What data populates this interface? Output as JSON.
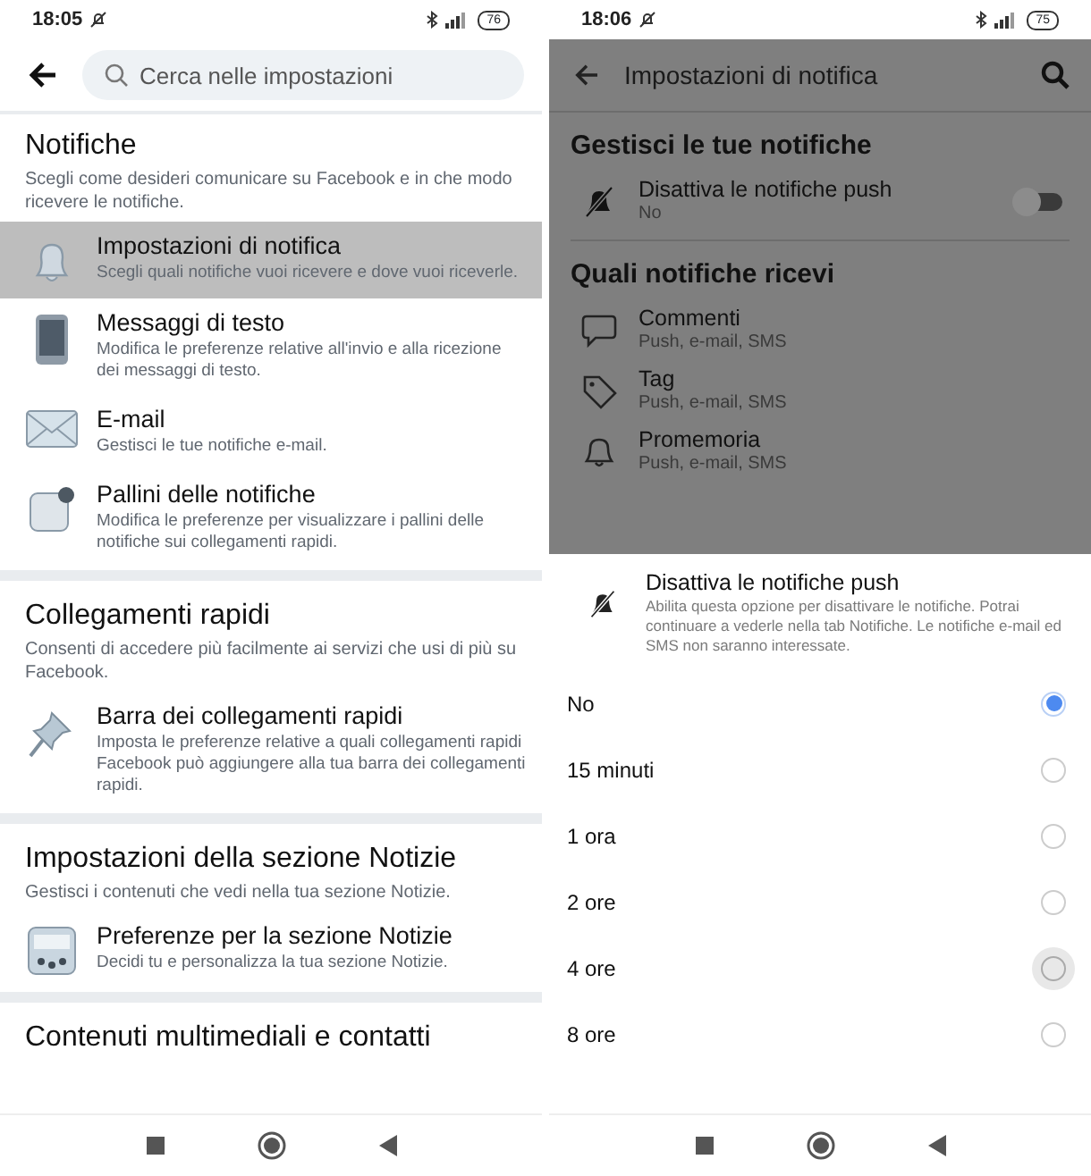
{
  "left": {
    "status_bar": {
      "time": "18:05",
      "battery": "76"
    },
    "search": {
      "placeholder": "Cerca nelle impostazioni"
    },
    "sections": [
      {
        "title": "Notifiche",
        "description": "Scegli come desideri comunicare su Facebook e in che modo ricevere le notifiche.",
        "items": [
          {
            "kind": "bell",
            "title": "Impostazioni di notifica",
            "subtitle": "Scegli quali notifiche vuoi ricevere e dove vuoi riceverle.",
            "selected": true
          },
          {
            "kind": "phone",
            "title": "Messaggi di testo",
            "subtitle": "Modifica le preferenze relative all'invio e alla ricezione dei messaggi di testo.",
            "selected": false
          },
          {
            "kind": "mail",
            "title": "E-mail",
            "subtitle": "Gestisci le tue notifiche e-mail.",
            "selected": false
          },
          {
            "kind": "badge",
            "title": "Pallini delle notifiche",
            "subtitle": "Modifica le preferenze per visualizzare i pallini delle notifiche sui collegamenti rapidi.",
            "selected": false
          }
        ]
      },
      {
        "title": "Collegamenti rapidi",
        "description": "Consenti di accedere più facilmente ai servizi che usi di più su Facebook.",
        "items": [
          {
            "kind": "pin",
            "title": "Barra dei collegamenti rapidi",
            "subtitle": "Imposta le preferenze relative a quali collegamenti rapidi Facebook può aggiungere alla tua barra dei collegamenti rapidi.",
            "selected": false
          }
        ]
      },
      {
        "title": "Impostazioni della sezione Notizie",
        "description": "Gestisci i contenuti che vedi nella tua sezione Notizie.",
        "items": [
          {
            "kind": "feed",
            "title": "Preferenze per la sezione Notizie",
            "subtitle": "Decidi tu e personalizza la tua sezione Notizie.",
            "selected": false
          }
        ]
      },
      {
        "title": "Contenuti multimediali e contatti"
      }
    ]
  },
  "right": {
    "status_bar": {
      "time": "18:06",
      "battery": "75"
    },
    "header": {
      "title": "Impostazioni di notifica"
    },
    "sections": [
      {
        "title": "Gestisci le tue notifiche",
        "rows": [
          {
            "kind": "mute",
            "title": "Disattiva le notifiche push",
            "subtitle": "No",
            "on": false
          }
        ]
      },
      {
        "title": "Quali notifiche ricevi",
        "rows": [
          {
            "kind": "comment",
            "title": "Commenti",
            "subtitle": "Push, e-mail, SMS"
          },
          {
            "kind": "tag",
            "title": "Tag",
            "subtitle": "Push, e-mail, SMS"
          },
          {
            "kind": "bell",
            "title": "Promemoria",
            "subtitle": "Push, e-mail, SMS"
          }
        ]
      }
    ],
    "sheet": {
      "title": "Disattiva le notifiche push",
      "description": "Abilita questa opzione per disattivare le notifiche. Potrai continuare a vederle nella tab Notifiche. Le notifiche e-mail ed SMS non saranno interessate.",
      "options": [
        {
          "label": "No",
          "selected": true,
          "pressed": false
        },
        {
          "label": "15 minuti",
          "selected": false,
          "pressed": false
        },
        {
          "label": "1 ora",
          "selected": false,
          "pressed": false
        },
        {
          "label": "2 ore",
          "selected": false,
          "pressed": false
        },
        {
          "label": "4 ore",
          "selected": false,
          "pressed": true
        },
        {
          "label": "8 ore",
          "selected": false,
          "pressed": false
        }
      ]
    }
  }
}
